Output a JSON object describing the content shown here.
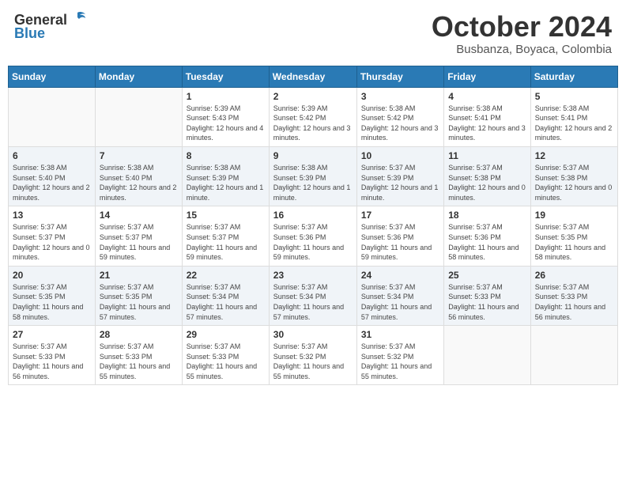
{
  "header": {
    "logo_general": "General",
    "logo_blue": "Blue",
    "month": "October 2024",
    "location": "Busbanza, Boyaca, Colombia"
  },
  "weekdays": [
    "Sunday",
    "Monday",
    "Tuesday",
    "Wednesday",
    "Thursday",
    "Friday",
    "Saturday"
  ],
  "weeks": [
    [
      {
        "day": "",
        "info": ""
      },
      {
        "day": "",
        "info": ""
      },
      {
        "day": "1",
        "info": "Sunrise: 5:39 AM\nSunset: 5:43 PM\nDaylight: 12 hours and 4 minutes."
      },
      {
        "day": "2",
        "info": "Sunrise: 5:39 AM\nSunset: 5:42 PM\nDaylight: 12 hours and 3 minutes."
      },
      {
        "day": "3",
        "info": "Sunrise: 5:38 AM\nSunset: 5:42 PM\nDaylight: 12 hours and 3 minutes."
      },
      {
        "day": "4",
        "info": "Sunrise: 5:38 AM\nSunset: 5:41 PM\nDaylight: 12 hours and 3 minutes."
      },
      {
        "day": "5",
        "info": "Sunrise: 5:38 AM\nSunset: 5:41 PM\nDaylight: 12 hours and 2 minutes."
      }
    ],
    [
      {
        "day": "6",
        "info": "Sunrise: 5:38 AM\nSunset: 5:40 PM\nDaylight: 12 hours and 2 minutes."
      },
      {
        "day": "7",
        "info": "Sunrise: 5:38 AM\nSunset: 5:40 PM\nDaylight: 12 hours and 2 minutes."
      },
      {
        "day": "8",
        "info": "Sunrise: 5:38 AM\nSunset: 5:39 PM\nDaylight: 12 hours and 1 minute."
      },
      {
        "day": "9",
        "info": "Sunrise: 5:38 AM\nSunset: 5:39 PM\nDaylight: 12 hours and 1 minute."
      },
      {
        "day": "10",
        "info": "Sunrise: 5:37 AM\nSunset: 5:39 PM\nDaylight: 12 hours and 1 minute."
      },
      {
        "day": "11",
        "info": "Sunrise: 5:37 AM\nSunset: 5:38 PM\nDaylight: 12 hours and 0 minutes."
      },
      {
        "day": "12",
        "info": "Sunrise: 5:37 AM\nSunset: 5:38 PM\nDaylight: 12 hours and 0 minutes."
      }
    ],
    [
      {
        "day": "13",
        "info": "Sunrise: 5:37 AM\nSunset: 5:37 PM\nDaylight: 12 hours and 0 minutes."
      },
      {
        "day": "14",
        "info": "Sunrise: 5:37 AM\nSunset: 5:37 PM\nDaylight: 11 hours and 59 minutes."
      },
      {
        "day": "15",
        "info": "Sunrise: 5:37 AM\nSunset: 5:37 PM\nDaylight: 11 hours and 59 minutes."
      },
      {
        "day": "16",
        "info": "Sunrise: 5:37 AM\nSunset: 5:36 PM\nDaylight: 11 hours and 59 minutes."
      },
      {
        "day": "17",
        "info": "Sunrise: 5:37 AM\nSunset: 5:36 PM\nDaylight: 11 hours and 59 minutes."
      },
      {
        "day": "18",
        "info": "Sunrise: 5:37 AM\nSunset: 5:36 PM\nDaylight: 11 hours and 58 minutes."
      },
      {
        "day": "19",
        "info": "Sunrise: 5:37 AM\nSunset: 5:35 PM\nDaylight: 11 hours and 58 minutes."
      }
    ],
    [
      {
        "day": "20",
        "info": "Sunrise: 5:37 AM\nSunset: 5:35 PM\nDaylight: 11 hours and 58 minutes."
      },
      {
        "day": "21",
        "info": "Sunrise: 5:37 AM\nSunset: 5:35 PM\nDaylight: 11 hours and 57 minutes."
      },
      {
        "day": "22",
        "info": "Sunrise: 5:37 AM\nSunset: 5:34 PM\nDaylight: 11 hours and 57 minutes."
      },
      {
        "day": "23",
        "info": "Sunrise: 5:37 AM\nSunset: 5:34 PM\nDaylight: 11 hours and 57 minutes."
      },
      {
        "day": "24",
        "info": "Sunrise: 5:37 AM\nSunset: 5:34 PM\nDaylight: 11 hours and 57 minutes."
      },
      {
        "day": "25",
        "info": "Sunrise: 5:37 AM\nSunset: 5:33 PM\nDaylight: 11 hours and 56 minutes."
      },
      {
        "day": "26",
        "info": "Sunrise: 5:37 AM\nSunset: 5:33 PM\nDaylight: 11 hours and 56 minutes."
      }
    ],
    [
      {
        "day": "27",
        "info": "Sunrise: 5:37 AM\nSunset: 5:33 PM\nDaylight: 11 hours and 56 minutes."
      },
      {
        "day": "28",
        "info": "Sunrise: 5:37 AM\nSunset: 5:33 PM\nDaylight: 11 hours and 55 minutes."
      },
      {
        "day": "29",
        "info": "Sunrise: 5:37 AM\nSunset: 5:33 PM\nDaylight: 11 hours and 55 minutes."
      },
      {
        "day": "30",
        "info": "Sunrise: 5:37 AM\nSunset: 5:32 PM\nDaylight: 11 hours and 55 minutes."
      },
      {
        "day": "31",
        "info": "Sunrise: 5:37 AM\nSunset: 5:32 PM\nDaylight: 11 hours and 55 minutes."
      },
      {
        "day": "",
        "info": ""
      },
      {
        "day": "",
        "info": ""
      }
    ]
  ]
}
